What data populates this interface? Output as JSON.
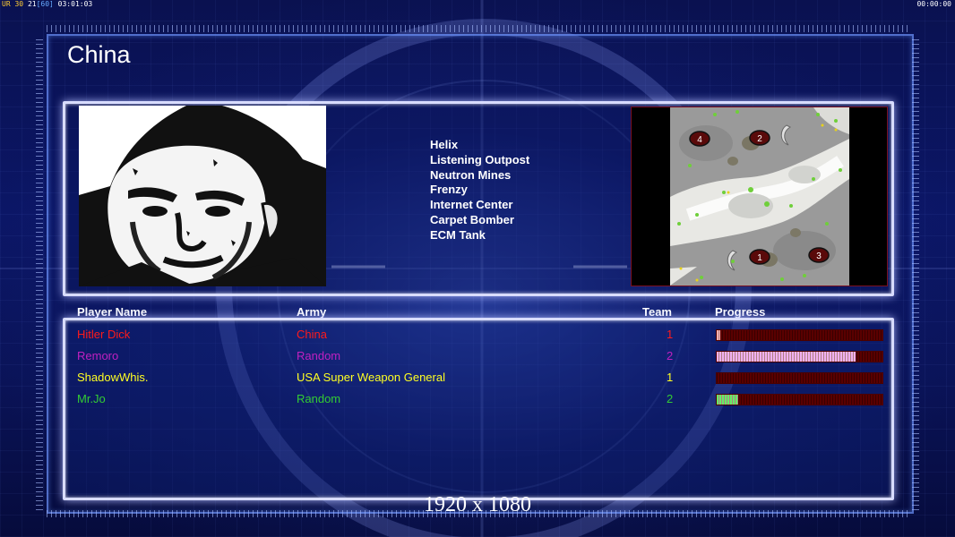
{
  "hud": {
    "left_prefix": "UR",
    "fps_current": "30",
    "fps_min": "21",
    "fps_limit": "[60]",
    "elapsed": "03:01:03",
    "right_timer": "00:00:00"
  },
  "faction_title": "China",
  "general_powers": [
    "Helix",
    "Listening Outpost",
    "Neutron Mines",
    "Frenzy",
    "Internet Center",
    "Carpet Bomber",
    "ECM Tank"
  ],
  "minimap": {
    "start_positions": [
      "1",
      "2",
      "3",
      "4"
    ]
  },
  "table": {
    "headers": {
      "player": "Player Name",
      "army": "Army",
      "team": "Team",
      "progress": "Progress"
    },
    "players": [
      {
        "name": "Hitler Dick",
        "army": "China",
        "team": "1",
        "color": "#ff1a1a",
        "progress": 0.02,
        "fill_color": "#ffb0b0"
      },
      {
        "name": "Remoro",
        "army": "Random",
        "team": "2",
        "color": "#c020c0",
        "progress": 0.84,
        "fill_color": "#f0b0f0"
      },
      {
        "name": "ShadowWhis.",
        "army": "USA Super Weapon General",
        "team": "1",
        "color": "#ffff22",
        "progress": 0.0,
        "fill_color": "#ffff88"
      },
      {
        "name": "Mr.Jo",
        "army": "Random",
        "team": "2",
        "color": "#33cc33",
        "progress": 0.13,
        "fill_color": "#66ee66"
      }
    ]
  },
  "resolution_label": "1920 x 1080",
  "colors": {
    "background": "#0b1666",
    "panel_border": "#d8dcff",
    "progress_track": "#5a0000"
  }
}
